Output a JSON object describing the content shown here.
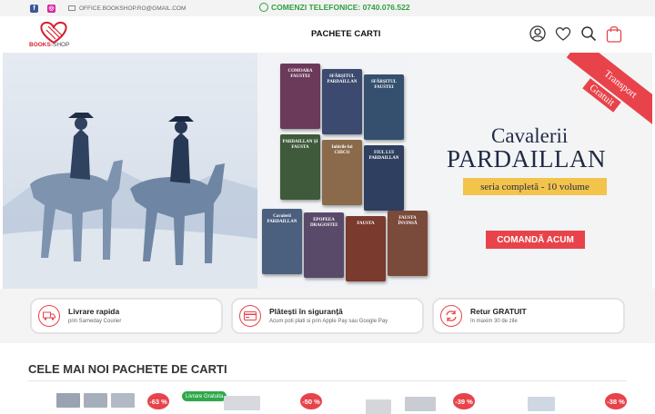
{
  "topbar": {
    "email": "OFFICE.BOOKSHOP.RO@GMAIL.COM",
    "phone": "COMENZI TELEFONICE: 0740.076.522",
    "icons": [
      "facebook-icon",
      "instagram-icon",
      "mail-icon",
      "phone-icon"
    ]
  },
  "header": {
    "logo_brand": "BOOKS",
    "logo_suffix": "-SHOP",
    "nav_item": "PACHETE CARTI",
    "icons": [
      "account-icon",
      "wishlist-heart-icon",
      "search-icon",
      "cart-bag-icon"
    ]
  },
  "banner": {
    "ribbon_line1": "Transport",
    "ribbon_line2": "Gratuit",
    "title_line1": "Cavalerii",
    "title_line2": "PARDAILLAN",
    "subtitle": "seria completă - 10 volume",
    "cta": "COMANDĂ ACUM",
    "books": [
      {
        "title": "COMOARA FAUSTEI",
        "color": "#6b3a5a"
      },
      {
        "title": "SFÂRȘITUL PARDAILLAN",
        "color": "#3b4a6e"
      },
      {
        "title": "SFÂRȘITUL FAUSTEI",
        "color": "#34506e"
      },
      {
        "title": "PARDAILLAN ȘI FAUSTA",
        "color": "#3f5a3a"
      },
      {
        "title": "Iubirile lui CHICO",
        "color": "#8a6a4a"
      },
      {
        "title": "FIUL LUI PARDAILLAN",
        "color": "#2f3f5f"
      },
      {
        "title": "Cavalerii PARDAILLAN",
        "color": "#4b5f7e"
      },
      {
        "title": "EPOPEEA DRAGOSTEI",
        "color": "#5a4a6a"
      },
      {
        "title": "FAUSTA",
        "color": "#7a3a2e"
      },
      {
        "title": "FAUSTA ÎNVINSĂ",
        "color": "#7a4a3a"
      }
    ],
    "colors": {
      "accent": "#e8434a",
      "navy": "#1f2a44",
      "gold": "#f3c44c"
    }
  },
  "features": [
    {
      "title": "Livrare rapida",
      "subtitle": "prin Sameday Courier",
      "icon": "truck-icon"
    },
    {
      "title": "Plătești în siguranță",
      "subtitle": "Acum poti plati si prin Apple Pay sau Google Pay",
      "icon": "credit-card-icon"
    },
    {
      "title": "Retur GRATUIT",
      "subtitle": "în maxim 30 de zile",
      "icon": "return-arrows-icon"
    }
  ],
  "products_section": {
    "title": "CELE MAI NOI PACHETE DE CARTI",
    "free_shipping_badge": "Livrare Gratuita",
    "discounts": [
      "-63 %",
      "-50 %",
      "-39 %",
      "-38 %"
    ]
  }
}
